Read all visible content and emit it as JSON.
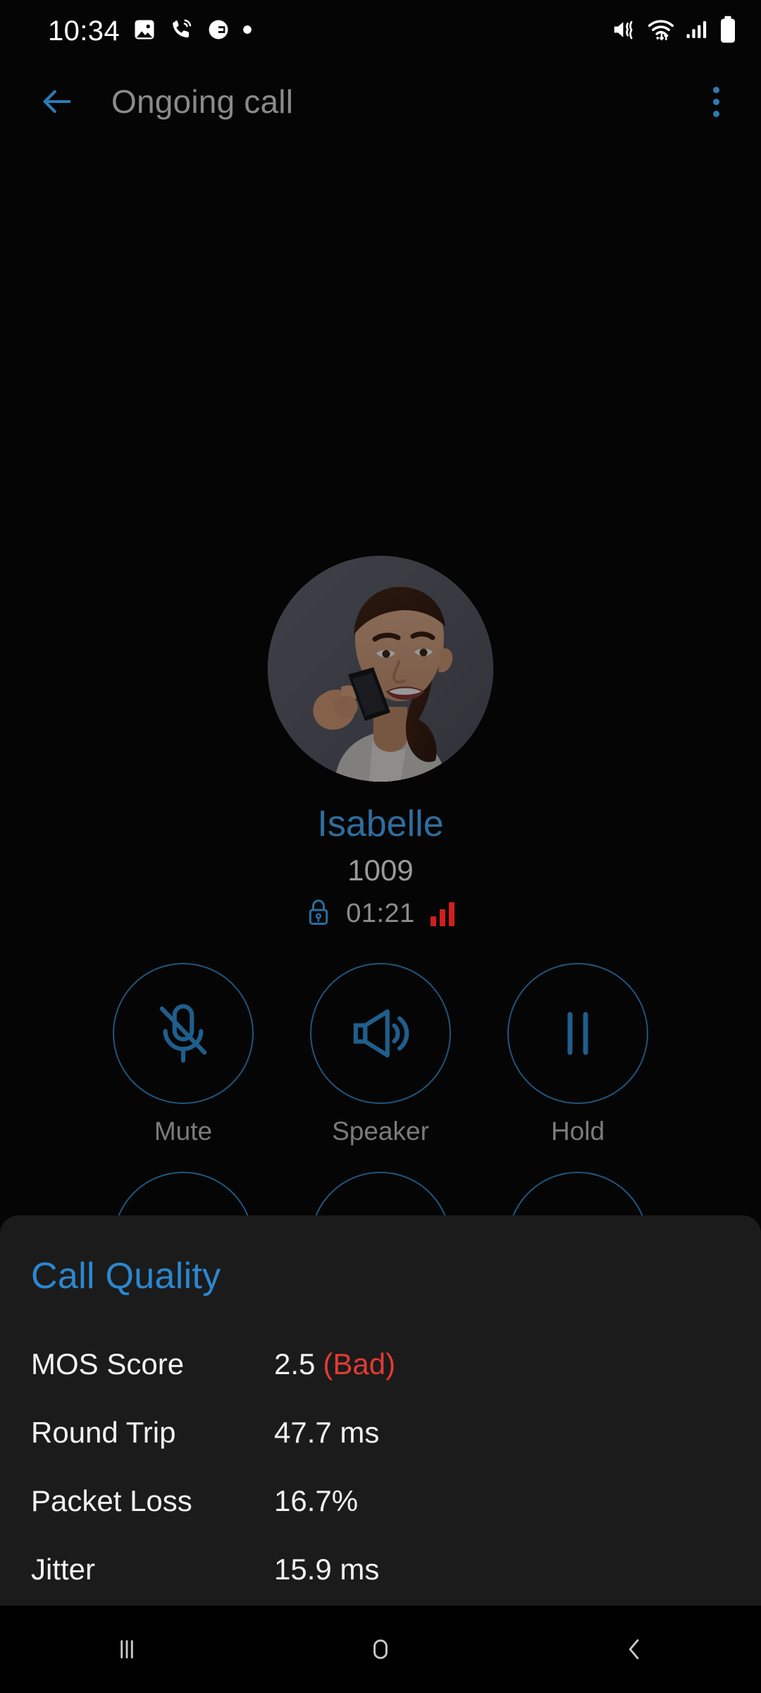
{
  "status_bar": {
    "time": "10:34",
    "battery_percent": "100%",
    "left_icons": [
      "image-icon",
      "call-forward-icon",
      "app-badge-icon",
      "dot-icon"
    ],
    "right_icons": [
      "mute-vibrate-icon",
      "wifi-icon",
      "cellular-signal-icon",
      "battery-icon"
    ]
  },
  "app_bar": {
    "title": "Ongoing call",
    "back_icon": "arrow-left-icon",
    "overflow_icon": "kebab-menu-icon",
    "accent_color": "#2e7bb5",
    "title_color": "#8a8a8a"
  },
  "call": {
    "contact_name": "Isabelle",
    "extension": "1009",
    "duration": "01:21",
    "encrypted_icon": "lock-icon",
    "signal_icon": "signal-bars-icon",
    "signal_color": "#d11f1f",
    "name_color": "#2e6e9e",
    "avatar": "contact-photo"
  },
  "controls": {
    "row1": [
      {
        "label": "Mute",
        "icon": "microphone-off-icon"
      },
      {
        "label": "Speaker",
        "icon": "speaker-icon"
      },
      {
        "label": "Hold",
        "icon": "pause-icon"
      }
    ],
    "row2": [
      {
        "label": "",
        "icon": "circle-button-icon"
      },
      {
        "label": "",
        "icon": "circle-button-icon"
      },
      {
        "label": "",
        "icon": "circle-button-icon"
      }
    ],
    "outline_color": "#20557c",
    "label_color": "#7b7b7b"
  },
  "call_quality": {
    "title": "Call Quality",
    "title_color": "#2b87cf",
    "metrics": [
      {
        "label": "MOS Score",
        "value": "2.5",
        "tag": "(Bad)",
        "tag_color": "#e23b33"
      },
      {
        "label": "Round Trip",
        "value": "47.7 ms",
        "tag": "",
        "tag_color": ""
      },
      {
        "label": "Packet Loss",
        "value": "16.7%",
        "tag": "",
        "tag_color": ""
      },
      {
        "label": "Jitter",
        "value": "15.9 ms",
        "tag": "",
        "tag_color": ""
      }
    ]
  },
  "nav_bar": {
    "recents_icon": "recents-icon",
    "home_icon": "home-icon",
    "back_icon": "back-chevron-icon"
  }
}
